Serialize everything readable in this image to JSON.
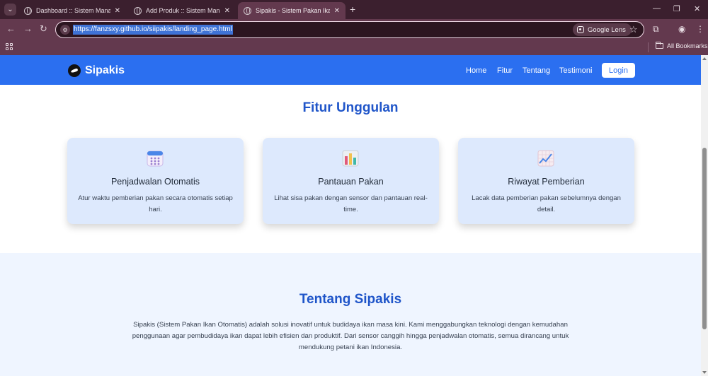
{
  "browser": {
    "tabs": [
      {
        "title": "Dashboard :: Sistem Manajemen",
        "active": false
      },
      {
        "title": "Add Produk :: Sistem Manajemen",
        "active": false
      },
      {
        "title": "Sipakis - Sistem Pakan Ikan Oto",
        "active": true
      }
    ],
    "url": "https://fanzsxy.github.io/siipakis/landing_page.html",
    "lens_label": "Google Lens",
    "all_bookmarks_label": "All Bookmarks"
  },
  "navbar": {
    "brand": "Sipakis",
    "links": [
      "Home",
      "Fitur",
      "Tentang",
      "Testimoni"
    ],
    "login_label": "Login"
  },
  "features": {
    "title": "Fitur Unggulan",
    "cards": [
      {
        "icon": "calendar-icon",
        "title": "Penjadwalan Otomatis",
        "description": "Atur waktu pemberian pakan secara otomatis setiap hari."
      },
      {
        "icon": "bar-chart-icon",
        "title": "Pantauan Pakan",
        "description": "Lihat sisa pakan dengan sensor dan pantauan real-time."
      },
      {
        "icon": "trend-chart-icon",
        "title": "Riwayat Pemberian",
        "description": "Lacak data pemberian pakan sebelumnya dengan detail."
      }
    ]
  },
  "about": {
    "title": "Tentang Sipakis",
    "text": "Sipakis (Sistem Pakan Ikan Otomatis) adalah solusi inovatif untuk budidaya ikan masa kini. Kami menggabungkan teknologi dengan kemudahan penggunaan agar pembudidaya ikan dapat lebih efisien dan produktif. Dari sensor canggih hingga penjadwalan otomatis, semua dirancang untuk mendukung petani ikan Indonesia."
  },
  "colors": {
    "primary": "#2b6ff0",
    "heading": "#1f55c9",
    "card_bg": "#dde9fd",
    "section_bg": "#eff5ff"
  }
}
